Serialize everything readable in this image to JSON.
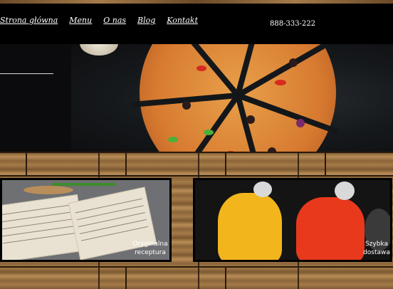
{
  "nav": {
    "items": [
      "Strona główna",
      "Menu",
      "O nas",
      "Blog",
      "Kontakt"
    ]
  },
  "contact": {
    "phone": "888-333-222"
  },
  "cards": [
    {
      "caption_line1": "Oryginalna",
      "caption_line2": "receptura"
    },
    {
      "caption_line1": "Szybka",
      "caption_line2": "dostawa"
    }
  ],
  "colors": {
    "nav_background": "#000000",
    "nav_text": "#ffffff",
    "wood": "#8a643a",
    "scooter_yellow": "#f2b51c",
    "scooter_red": "#e8391c"
  }
}
